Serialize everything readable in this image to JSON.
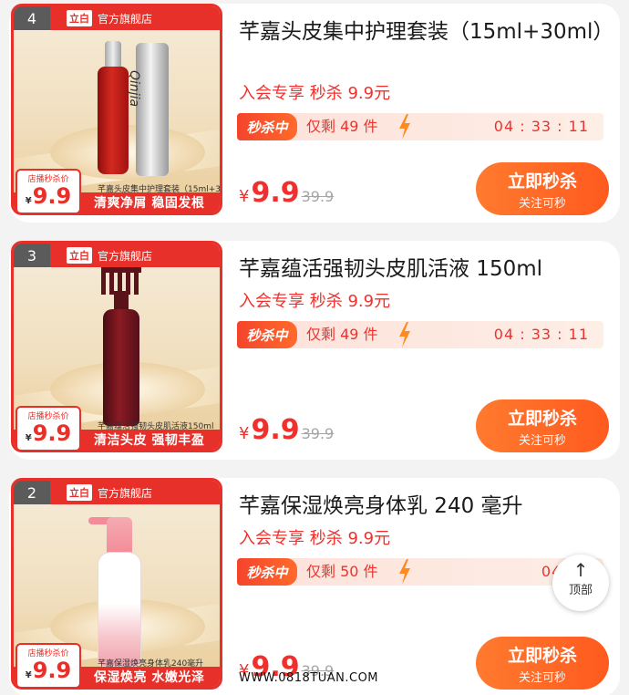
{
  "items": [
    {
      "rank": "4",
      "brand_logo": "立白",
      "shop": "官方旗舰店",
      "badge_label": "店播秒杀价",
      "badge_currency": "¥",
      "badge_price": "9.9",
      "caption": "芊嘉头皮集中护理套装（15ml+30ml）",
      "slogan": "清爽净屑 稳固发根",
      "title": "芊嘉头皮集中护理套装（15ml+30ml）",
      "member_text": "入会专享 秒杀 9.9元",
      "flash_tag": "秒杀中",
      "remaining": "仅剩 49 件",
      "countdown": "04 : 33 : 11",
      "currency": "¥",
      "price": "9.9",
      "original_price": "39.9",
      "buy_label": "立即秒杀",
      "buy_sub": "关注可秒",
      "tube_text": "Qinjia"
    },
    {
      "rank": "3",
      "brand_logo": "立白",
      "shop": "官方旗舰店",
      "badge_label": "店播秒杀价",
      "badge_currency": "¥",
      "badge_price": "9.9",
      "caption": "芊嘉蕴活强韧头皮肌活液150ml",
      "slogan": "清洁头皮 强韧丰盈",
      "title": "芊嘉蕴活强韧头皮肌活液 150ml",
      "member_text": "入会专享 秒杀 9.9元",
      "flash_tag": "秒杀中",
      "remaining": "仅剩 49 件",
      "countdown": "04 : 33 : 11",
      "currency": "¥",
      "price": "9.9",
      "original_price": "39.9",
      "buy_label": "立即秒杀",
      "buy_sub": "关注可秒"
    },
    {
      "rank": "2",
      "brand_logo": "立白",
      "shop": "官方旗舰店",
      "badge_label": "店播秒杀价",
      "badge_currency": "¥",
      "badge_price": "9.9",
      "caption": "芊嘉保湿焕亮身体乳240毫升",
      "slogan": "保湿焕亮 水嫩光泽",
      "title": "芊嘉保湿焕亮身体乳 240 毫升",
      "member_text": "入会专享 秒杀 9.9元",
      "flash_tag": "秒杀中",
      "remaining": "仅剩 50 件",
      "countdown": "04 : 3",
      "currency": "¥",
      "price": "9.9",
      "original_price": "39.9",
      "buy_label": "立即秒杀",
      "buy_sub": "关注可秒"
    }
  ],
  "back_to_top": {
    "arrow": "↑",
    "label": "顶部"
  },
  "watermark": "WWW.0818TUAN.COM",
  "colors": {
    "accent": "#f0302c",
    "button": "#ff6a2b",
    "flash_bg": "#fde1d9"
  }
}
